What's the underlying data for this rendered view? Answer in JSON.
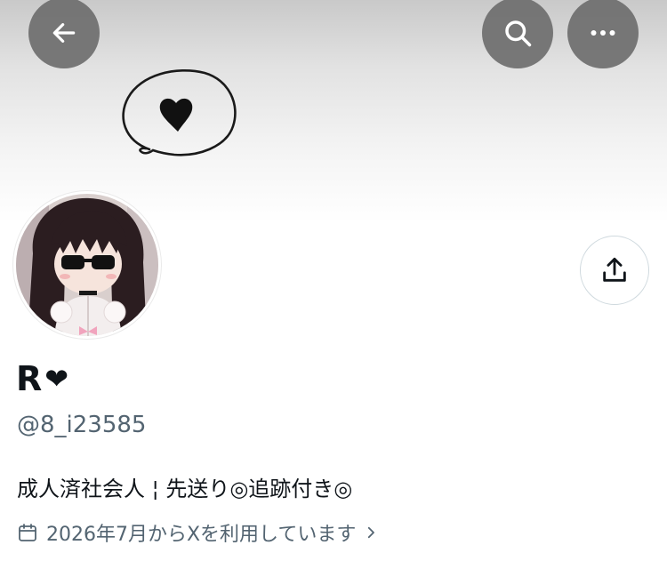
{
  "profile": {
    "name": "R",
    "name_heart": "❤",
    "handle": "@8_i23585",
    "bio": "成人済社会人 ¦ 先送り◎追跡付き◎",
    "joined": "2026年7月からXを利用しています"
  },
  "icons": {
    "back": "arrow-left-icon",
    "search": "search-icon",
    "more": "more-horizontal-icon",
    "share": "share-upload-icon",
    "calendar": "calendar-icon",
    "chevron": "chevron-right-icon"
  },
  "colors": {
    "overlay_button": "#6e6e6e",
    "text_primary": "#0f1419",
    "text_secondary": "#536471",
    "border": "#cfd9de"
  }
}
